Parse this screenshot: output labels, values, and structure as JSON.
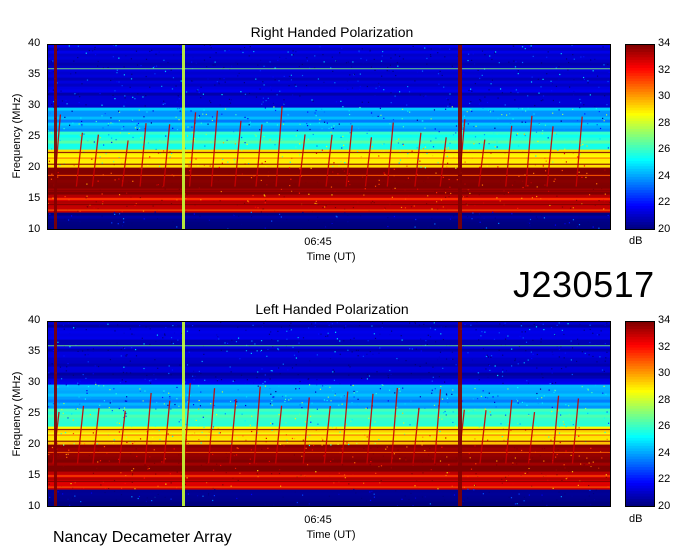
{
  "page": {
    "observation_id": "J230517",
    "instrument": "Nancay Decameter Array"
  },
  "colorbar": {
    "min": 20,
    "max": 34,
    "ticks": [
      "34",
      "32",
      "30",
      "28",
      "26",
      "24",
      "22",
      "20"
    ],
    "unit": "dB",
    "colors": [
      "#00007f",
      "#0000ff",
      "#007fff",
      "#00ffff",
      "#7fff7f",
      "#ffff00",
      "#ff7f00",
      "#ff0000",
      "#7f0000"
    ]
  },
  "chart_data": [
    {
      "type": "heatmap",
      "title": "Right Handed Polarization",
      "xlabel": "Time (UT)",
      "ylabel": "Frequency (MHz)",
      "x_ticks": [
        "06:45"
      ],
      "y_ticks": [
        "40",
        "35",
        "30",
        "25",
        "20",
        "15",
        "10"
      ],
      "ylim": [
        10,
        40
      ],
      "z_unit": "dB",
      "zlim": [
        20,
        34
      ],
      "bands": [
        {
          "f_low": 10,
          "f_high": 13,
          "level_db": 20
        },
        {
          "f_low": 13,
          "f_high": 16,
          "level_db": 33
        },
        {
          "f_low": 16,
          "f_high": 20,
          "level_db": 34
        },
        {
          "f_low": 20,
          "f_high": 23,
          "level_db": 29
        },
        {
          "f_low": 23,
          "f_high": 26,
          "level_db": 26
        },
        {
          "f_low": 26,
          "f_high": 30,
          "level_db": 24
        },
        {
          "f_low": 30,
          "f_high": 40,
          "level_db": 21
        }
      ]
    },
    {
      "type": "heatmap",
      "title": "Left Handed Polarization",
      "xlabel": "Time (UT)",
      "ylabel": "Frequency (MHz)",
      "x_ticks": [
        "06:45"
      ],
      "y_ticks": [
        "40",
        "35",
        "30",
        "25",
        "20",
        "15",
        "10"
      ],
      "ylim": [
        10,
        40
      ],
      "z_unit": "dB",
      "zlim": [
        20,
        34
      ],
      "bands": [
        {
          "f_low": 10,
          "f_high": 13,
          "level_db": 20
        },
        {
          "f_low": 13,
          "f_high": 16,
          "level_db": 33
        },
        {
          "f_low": 16,
          "f_high": 20,
          "level_db": 34
        },
        {
          "f_low": 20,
          "f_high": 23,
          "level_db": 29
        },
        {
          "f_low": 23,
          "f_high": 26,
          "level_db": 26
        },
        {
          "f_low": 26,
          "f_high": 30,
          "level_db": 24
        },
        {
          "f_low": 30,
          "f_high": 40,
          "level_db": 21
        }
      ]
    }
  ]
}
